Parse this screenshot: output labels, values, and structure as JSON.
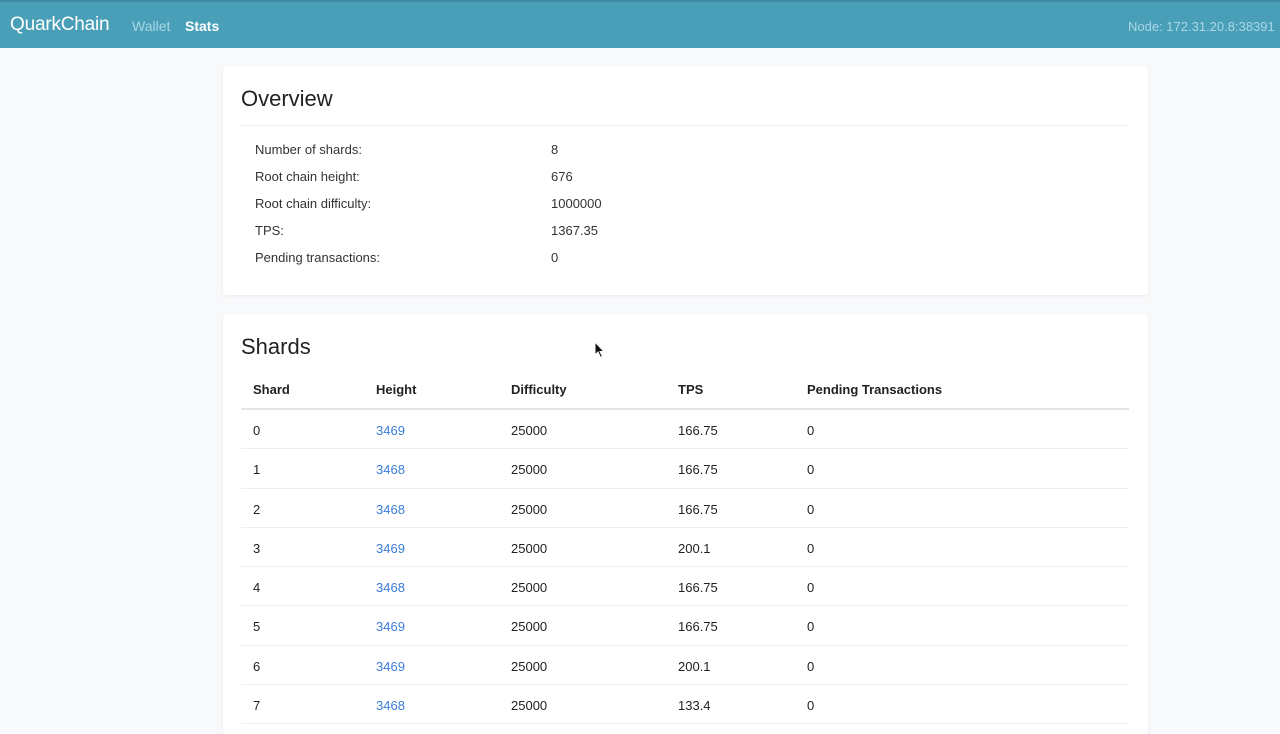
{
  "nav": {
    "brand": "QuarkChain",
    "links": [
      {
        "label": "Wallet",
        "active": false
      },
      {
        "label": "Stats",
        "active": true
      }
    ],
    "node": "Node: 172.31.20.8:38391"
  },
  "overview": {
    "title": "Overview",
    "rows": [
      {
        "label": "Number of shards:",
        "value": "8"
      },
      {
        "label": "Root chain height:",
        "value": "676"
      },
      {
        "label": "Root chain difficulty:",
        "value": "1000000"
      },
      {
        "label": "TPS:",
        "value": "1367.35"
      },
      {
        "label": "Pending transactions:",
        "value": "0"
      }
    ]
  },
  "shards": {
    "title": "Shards",
    "columns": [
      "Shard",
      "Height",
      "Difficulty",
      "TPS",
      "Pending Transactions"
    ],
    "rows": [
      {
        "shard": "0",
        "height": "3469",
        "difficulty": "25000",
        "tps": "166.75",
        "pending": "0"
      },
      {
        "shard": "1",
        "height": "3468",
        "difficulty": "25000",
        "tps": "166.75",
        "pending": "0"
      },
      {
        "shard": "2",
        "height": "3468",
        "difficulty": "25000",
        "tps": "166.75",
        "pending": "0"
      },
      {
        "shard": "3",
        "height": "3469",
        "difficulty": "25000",
        "tps": "200.1",
        "pending": "0"
      },
      {
        "shard": "4",
        "height": "3468",
        "difficulty": "25000",
        "tps": "166.75",
        "pending": "0"
      },
      {
        "shard": "5",
        "height": "3469",
        "difficulty": "25000",
        "tps": "166.75",
        "pending": "0"
      },
      {
        "shard": "6",
        "height": "3469",
        "difficulty": "25000",
        "tps": "200.1",
        "pending": "0"
      },
      {
        "shard": "7",
        "height": "3468",
        "difficulty": "25000",
        "tps": "133.4",
        "pending": "0"
      }
    ]
  },
  "colors": {
    "navbar": "#4a9fb8",
    "link": "#3b7dd8",
    "inactive_nav": "#a9d8e6"
  },
  "icons": [
    "mouse-cursor-icon"
  ]
}
